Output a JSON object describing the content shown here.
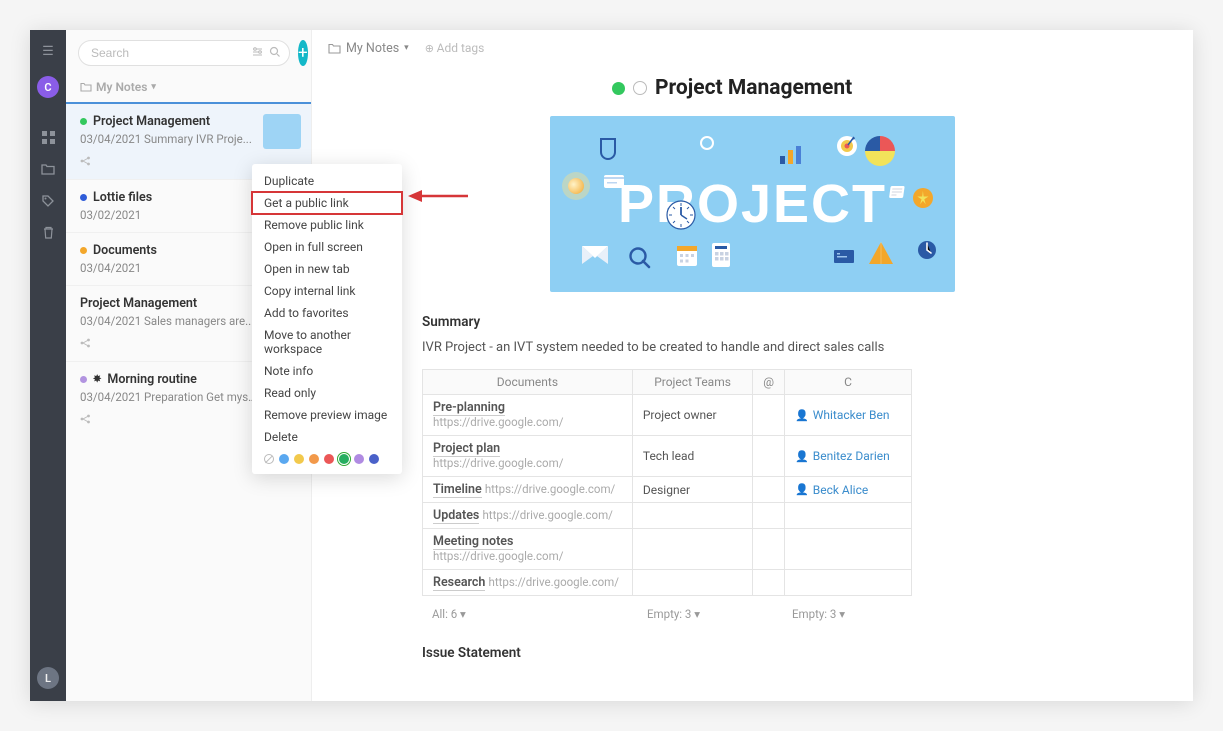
{
  "rail": {
    "avatar_top": "C",
    "avatar_bottom": "L"
  },
  "search": {
    "placeholder": "Search"
  },
  "folder": {
    "label": "My Notes"
  },
  "notes": [
    {
      "title": "Project Management",
      "subtitle": "03/04/2021 Summary IVR Proje...",
      "dot": "#33c85e",
      "has_thumb": true,
      "has_share": true,
      "active": true
    },
    {
      "title": "Lottie files",
      "subtitle": "03/02/2021",
      "dot": "#2f5cd8",
      "has_thumb": false,
      "has_share": false,
      "active": false
    },
    {
      "title": "Documents",
      "subtitle": "03/04/2021",
      "dot": "#f3a72b",
      "has_thumb": false,
      "has_share": false,
      "active": false
    },
    {
      "title": "Project Management",
      "subtitle": "03/04/2021 Sales managers are...",
      "dot": "",
      "has_thumb": false,
      "has_share": true,
      "active": false
    },
    {
      "title": "Morning routine",
      "subtitle": "03/04/2021 Preparation Get mysel...",
      "prefix_icon": "✸",
      "dot": "#b294e0",
      "has_thumb": false,
      "has_share": true,
      "active": false
    }
  ],
  "breadcrumb": {
    "folder": "My Notes",
    "add_tags": "Add tags"
  },
  "document": {
    "title": "Project Management",
    "hero_word": "PROJECT",
    "summary_heading": "Summary",
    "summary_text": "IVR Project - an IVT system needed to be created to handle and direct sales calls",
    "issue_heading": "Issue Statement",
    "table": {
      "headers": [
        "Documents",
        "Project Teams",
        "@",
        "C"
      ],
      "rows": [
        {
          "doc": "Pre-planning",
          "url": "https://drive.google.com/",
          "team": "Project owner",
          "contact": "Whitacker Ben"
        },
        {
          "doc": "Project plan",
          "url": "https://drive.google.com/",
          "team": "Tech lead",
          "contact": "Benitez Darien"
        },
        {
          "doc": "Timeline",
          "url": "https://drive.google.com/",
          "team": "Designer",
          "contact": "Beck Alice"
        },
        {
          "doc": "Updates",
          "url": "https://drive.google.com/",
          "team": "",
          "contact": ""
        },
        {
          "doc": "Meeting notes",
          "url": "https://drive.google.com/",
          "team": "",
          "contact": ""
        },
        {
          "doc": "Research",
          "url": "https://drive.google.com/",
          "team": "",
          "contact": ""
        }
      ],
      "footer": [
        "All: 6  ▾",
        "Empty: 3  ▾",
        "Empty: 3  ▾"
      ]
    }
  },
  "context_menu": {
    "items": [
      "Duplicate",
      "Get a public link",
      "Remove public link",
      "Open in full screen",
      "Open in new tab",
      "Copy internal link",
      "Add to favorites",
      "Move to another workspace",
      "Note info",
      "Read only",
      "Remove preview image",
      "Delete"
    ],
    "highlight_index": 1,
    "colors": [
      "#5aa8f0",
      "#f2c94c",
      "#f2994a",
      "#eb5757",
      "#27ae60",
      "#b08be2",
      "#4a61c9"
    ],
    "selected_color_index": 4
  }
}
